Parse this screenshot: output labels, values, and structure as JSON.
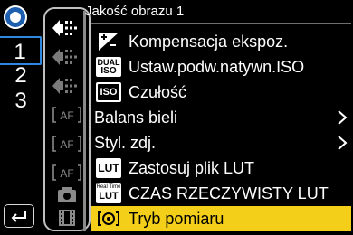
{
  "header": {
    "title": "Jakość obrazu 1"
  },
  "pages": {
    "tabs": [
      {
        "label": "1",
        "active": true
      },
      {
        "label": "2",
        "active": false
      },
      {
        "label": "3",
        "active": false
      }
    ]
  },
  "side_icons": [
    "photo-format-icon-active",
    "photo-format-icon",
    "photo-format-icon",
    "af-icon",
    "af-icon",
    "af-icon",
    "camera-icon",
    "film-icon"
  ],
  "af_label": "AF",
  "menu": {
    "items": [
      {
        "label": "Kompensacja ekspoz.",
        "icon": "exposure-comp-icon",
        "has_arrow": false,
        "selected": false
      },
      {
        "label": "Ustaw.podw.natywn.ISO",
        "icon": "dual-iso-icon",
        "icon_line1": "DUAL",
        "icon_line2": "ISO",
        "has_arrow": false,
        "selected": false
      },
      {
        "label": "Czułość",
        "icon": "iso-icon",
        "icon_text": "ISO",
        "has_arrow": false,
        "selected": false
      },
      {
        "label": "Balans bieli",
        "icon": "",
        "has_arrow": true,
        "selected": false
      },
      {
        "label": "Styl. zdj.",
        "icon": "",
        "has_arrow": true,
        "selected": false
      },
      {
        "label": "Zastosuj plik LUT",
        "icon": "lut-icon",
        "icon_text": "LUT",
        "has_arrow": false,
        "selected": false
      },
      {
        "label": "CZAS RZECZYWISTY LUT",
        "icon": "realtime-lut-icon",
        "icon_line1": "Real Time",
        "icon_line2": "LUT",
        "has_arrow": false,
        "selected": false
      },
      {
        "label": "Tryb pomiaru",
        "icon": "metering-mode-icon",
        "has_arrow": false,
        "selected": true
      }
    ]
  },
  "colors": {
    "background": "#000000",
    "selection": "#f4cf19",
    "active_tab_border": "#2f88e0",
    "text": "#ffffff"
  }
}
